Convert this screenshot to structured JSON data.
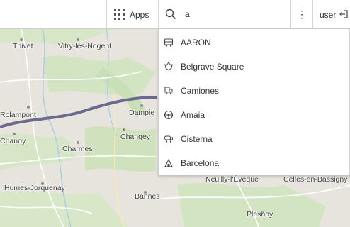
{
  "topbar": {
    "apps_label": "Apps",
    "apps_icon": "grid-icon",
    "search_icon": "search-icon",
    "search_value": "a",
    "more_label": "⋮",
    "user_label": "user",
    "logout_icon": "logout-icon"
  },
  "suggestions": [
    {
      "label": "AARON",
      "icon": "bus-icon"
    },
    {
      "label": "Belgrave Square",
      "icon": "park-icon"
    },
    {
      "label": "Camiones",
      "icon": "truck-stop-icon"
    },
    {
      "label": "Amaia",
      "icon": "steering-wheel-icon"
    },
    {
      "label": "Cisterna",
      "icon": "tanker-icon"
    },
    {
      "label": "Barcelona",
      "icon": "depot-icon"
    }
  ],
  "map": {
    "places": [
      "Thivet",
      "Vitry-lès-Nogent",
      "Rolampont",
      "Dampie",
      "Chanoy",
      "Changey",
      "Charmes",
      "Humes-Jorquenay",
      "Bannes",
      "Plesnoy",
      "Celles-en-Bassigny",
      "Neuilly-l'Évêque"
    ],
    "route_color": "#6b6a8e"
  }
}
